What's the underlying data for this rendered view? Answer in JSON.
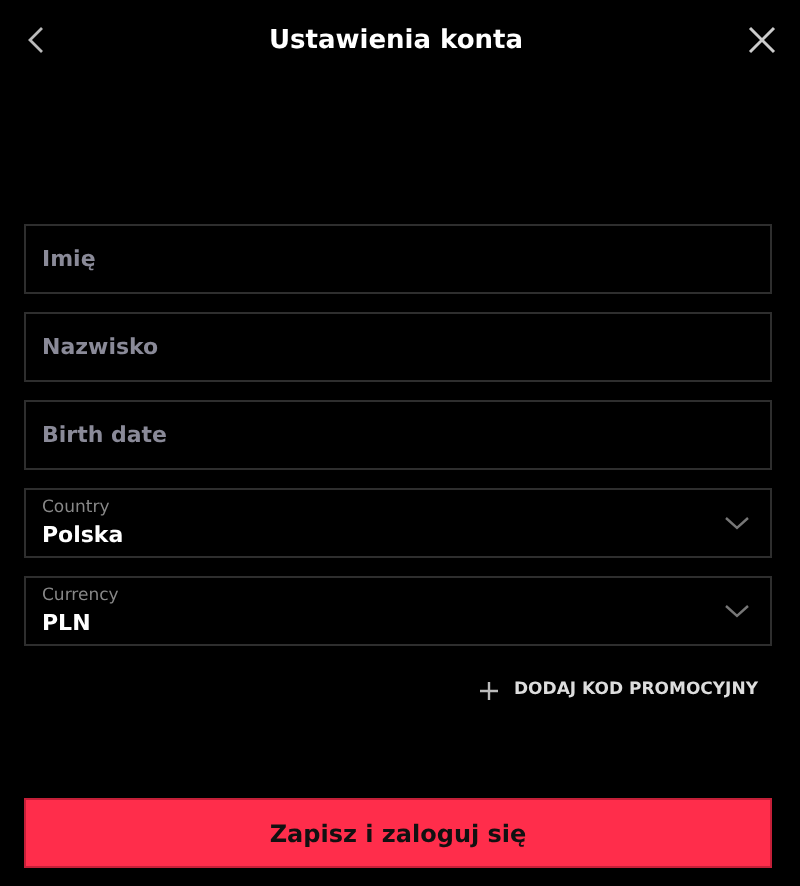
{
  "header": {
    "title": "Ustawienia konta"
  },
  "fields": [
    {
      "kind": "text",
      "placeholder": "Imię"
    },
    {
      "kind": "text",
      "placeholder": "Nazwisko"
    },
    {
      "kind": "text",
      "placeholder": "Birth date"
    },
    {
      "kind": "select",
      "label": "Country",
      "value": "Polska"
    },
    {
      "kind": "select",
      "label": "Currency",
      "value": "PLN"
    }
  ],
  "promo_link": "DODAJ KOD PROMOCYJNY",
  "submit_button": "Zapisz i zaloguj się"
}
